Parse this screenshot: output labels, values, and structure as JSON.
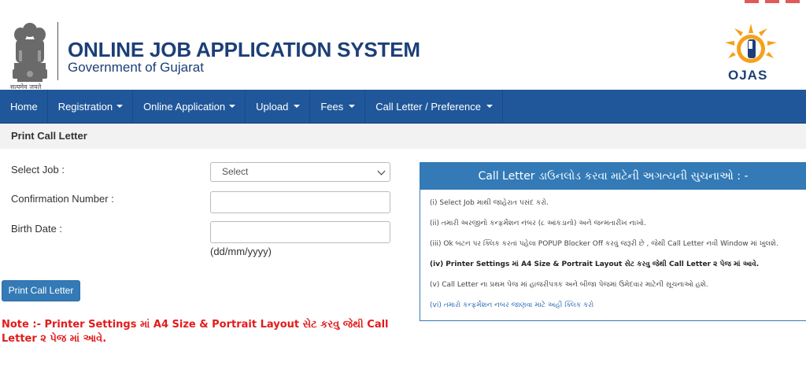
{
  "header": {
    "title": "ONLINE JOB APPLICATION SYSTEM",
    "subtitle": "Government of Gujarat",
    "emblem_motto": "सत्यमेव जयते",
    "logo_text": "OJAS",
    "title_color": "#1c3f78"
  },
  "nav": {
    "items": [
      {
        "label": "Home",
        "dropdown": false
      },
      {
        "label": "Registration",
        "dropdown": true
      },
      {
        "label": "Online Application",
        "dropdown": true
      },
      {
        "label": "Upload",
        "dropdown": true
      },
      {
        "label": "Fees",
        "dropdown": true
      },
      {
        "label": "Call Letter / Preference",
        "dropdown": true
      }
    ],
    "color": "#20579a"
  },
  "panel": {
    "heading": "Print Call Letter"
  },
  "form": {
    "select_job_label": "Select Job :",
    "select_job_value": "Select",
    "confirmation_label": "Confirmation Number :",
    "confirmation_value": "",
    "birth_label": "Birth Date :",
    "birth_value": "",
    "birth_hint": "(dd/mm/yyyy)",
    "print_button": "Print Call Letter"
  },
  "note": "Note :- Printer Settings માં A4 Size & Portrait Layout સેટ કરવુ જેથી Call Letter ૨ પેજ માં આવે.",
  "instructions": {
    "title": "Call Letter ડાઉનલોડ કરવા માટેની અગત્યની સુચનાઓ : -",
    "items": [
      {
        "text": "(i) Select Job માથી જાહેરાત પસંદ કરો.",
        "style": "normal"
      },
      {
        "text": "(ii) તમારી અરજીનો કન્ફર્મેશન નંબર (૮ આંકડાનો) અને જન્મતારીખ નાખો.",
        "style": "normal"
      },
      {
        "text": "(iii) Ok બટન પર ક્લિક કરતાં પહેલા POPUP Blocker Off કરવું જરૂરી છે , જેથી Call Letter નવી Window માં ખુલશે.",
        "style": "normal"
      },
      {
        "text": "(iv) Printer Settings માં A4 Size & Portrait Layout સેટ કરવુ જેથી Call Letter ૨ પેજ માં આવે.",
        "style": "bold"
      },
      {
        "text": "(v) Call Letter ના પ્રથમ પેજ માં હાજરીપત્રક અને બીજા પેજમાં ઉમેદવાર માટેની સૂચનાઓ હશે.",
        "style": "normal"
      },
      {
        "text": "(vi) તમારો કન્ફર્મેશન નબર જાણવા માટે અહી ક્લિક કરો",
        "style": "link"
      }
    ],
    "accent": "#337ab7"
  }
}
